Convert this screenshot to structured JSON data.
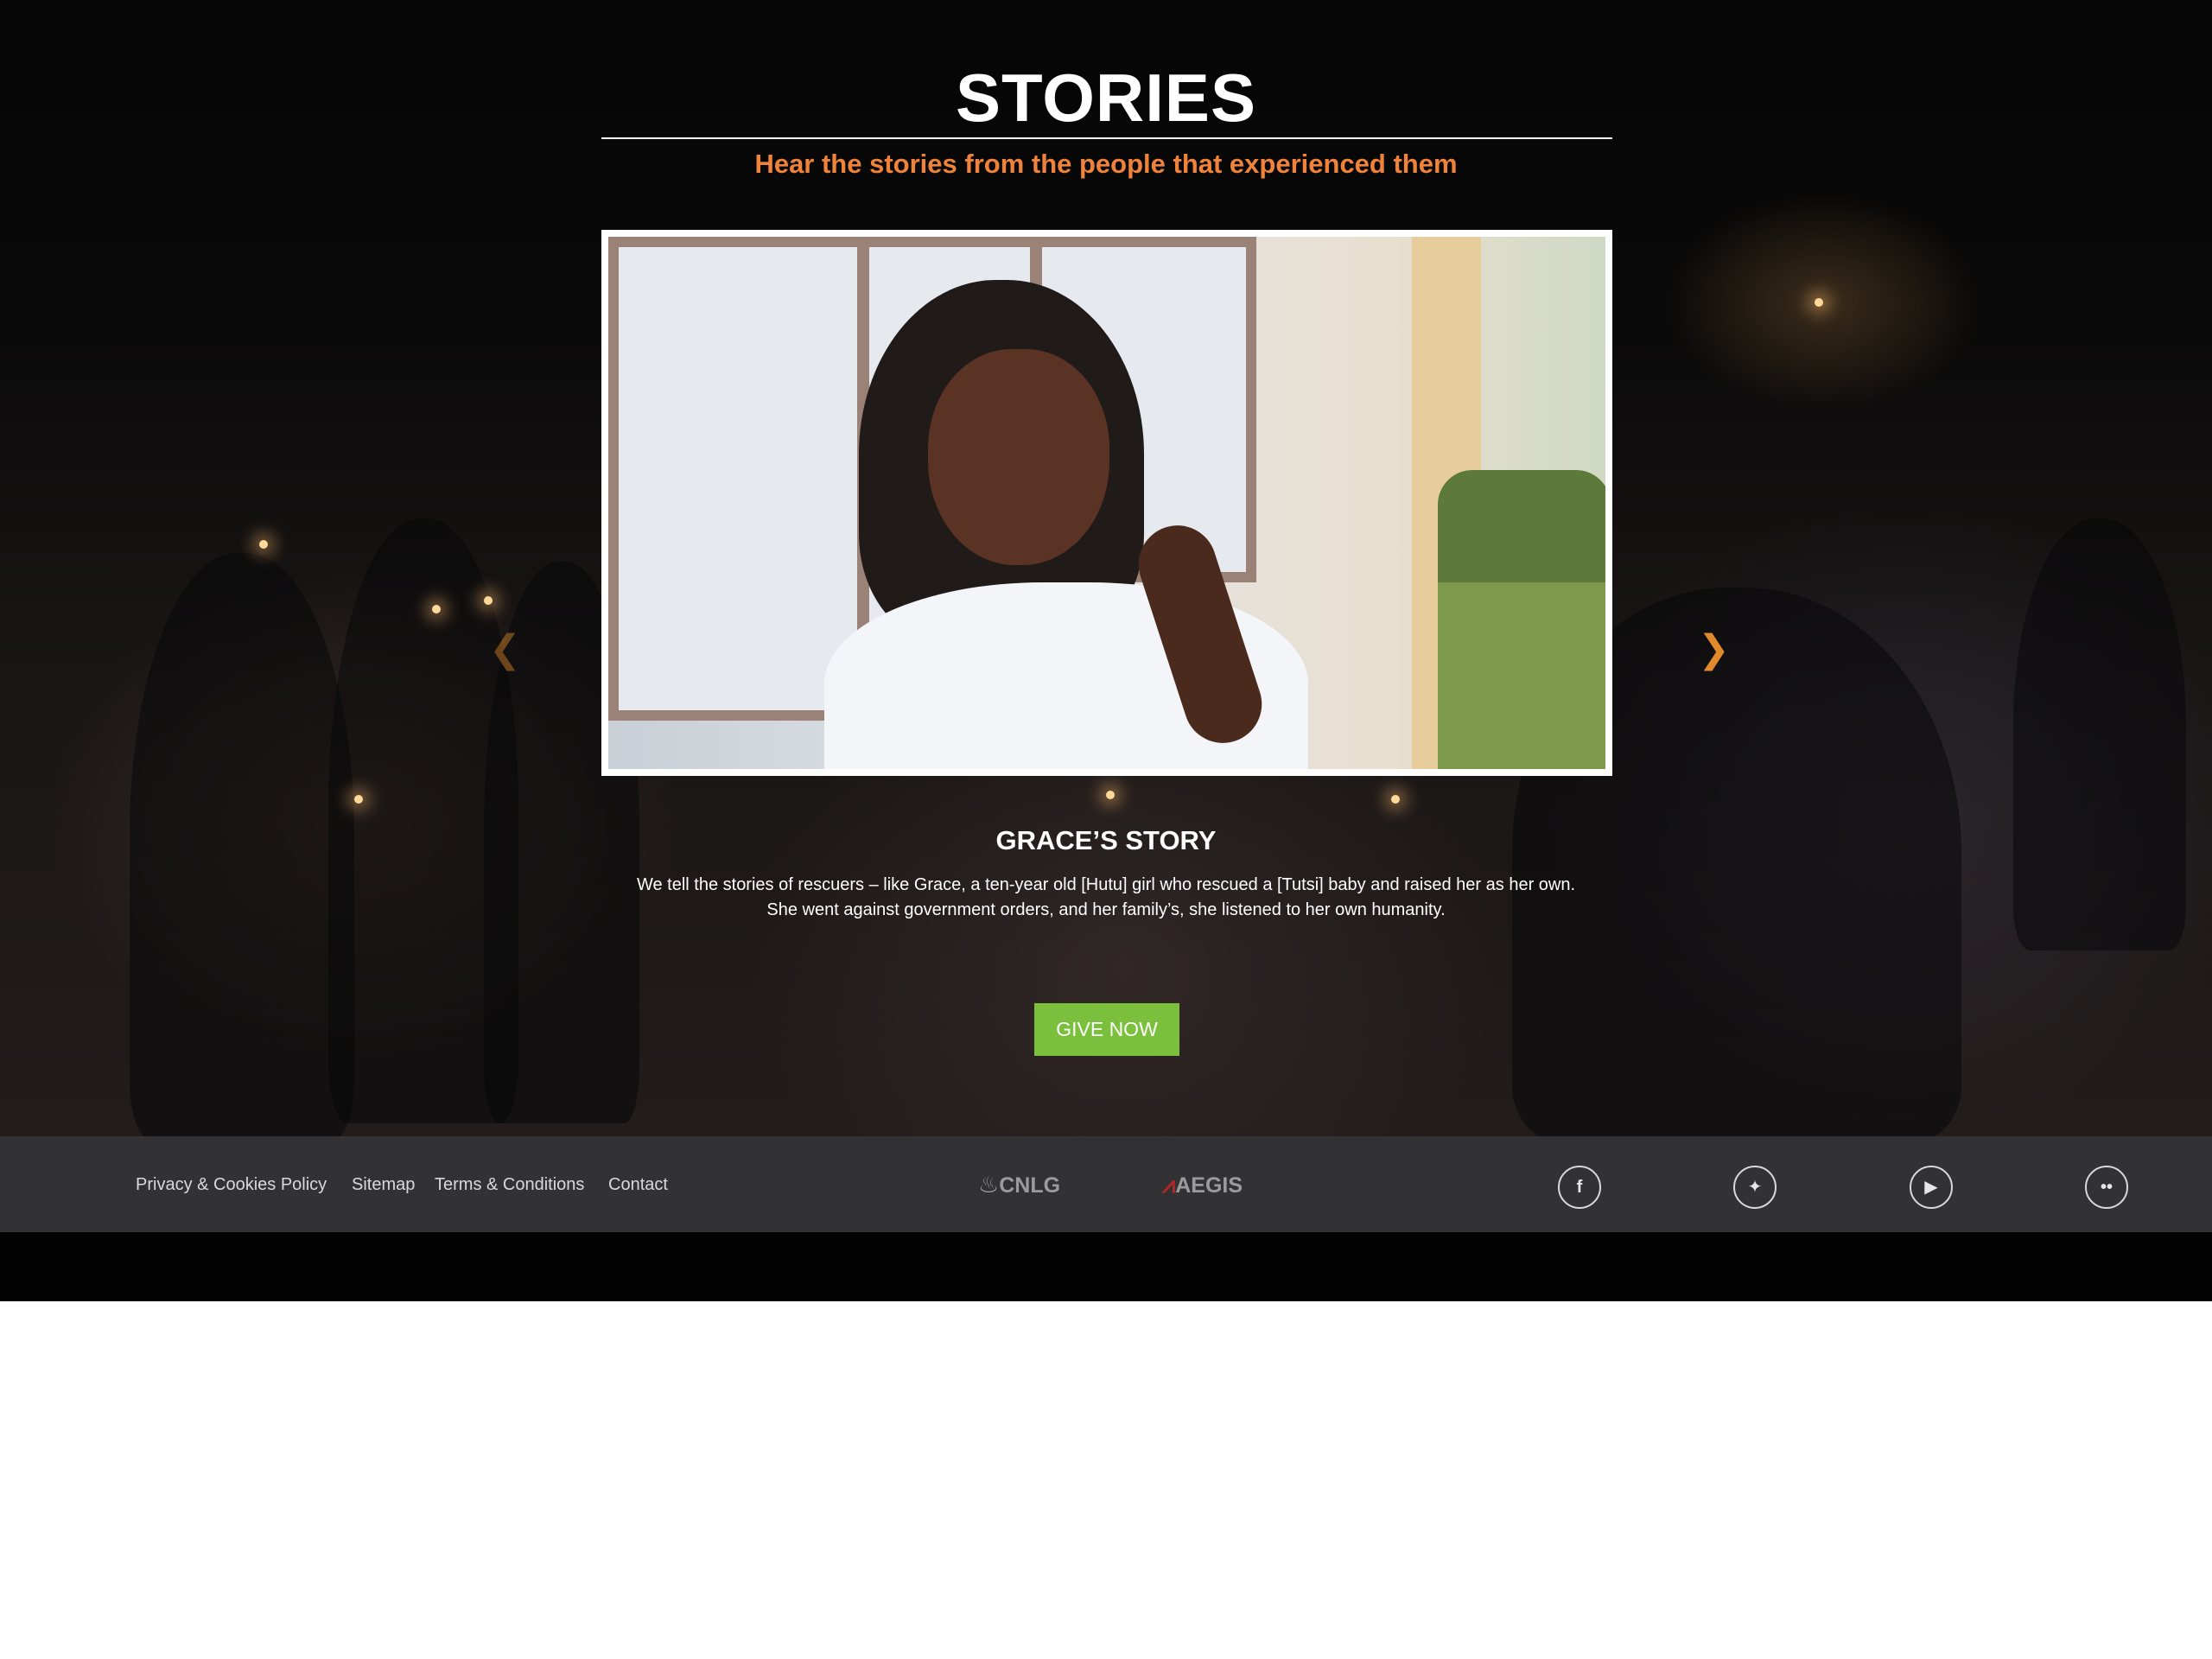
{
  "hero": {
    "title": "STORIES",
    "subtitle": "Hear the stories from the people that experienced them"
  },
  "carousel": {
    "prev_icon": "chevron-left-icon",
    "next_icon": "chevron-right-icon",
    "prev_glyph": "❮",
    "next_glyph": "❯"
  },
  "story": {
    "title": "GRACE’S STORY",
    "line1": "We tell the stories of rescuers – like Grace, a ten-year old [Hutu] girl who rescued a [Tutsi] baby and raised her as her own.",
    "line2": "She went against government orders, and her family’s, she listened to her own humanity."
  },
  "cta": {
    "label": "GIVE NOW",
    "color": "#7bc03c"
  },
  "footer": {
    "links": [
      "Privacy & Cookies Policy",
      "Sitemap",
      "Terms & Conditions",
      "Contact"
    ],
    "logos": [
      {
        "mark": "♨",
        "text": "CNLG"
      },
      {
        "mark": "⩘",
        "text": "AEGIS"
      }
    ],
    "social": [
      {
        "icon": "facebook-icon",
        "glyph": "f"
      },
      {
        "icon": "twitter-icon",
        "glyph": "✦"
      },
      {
        "icon": "youtube-icon",
        "glyph": "▶"
      },
      {
        "icon": "flickr-icon",
        "glyph": "••"
      }
    ]
  },
  "colors": {
    "accent_orange": "#f0833a",
    "footer_bg": "#323234",
    "hero_bg": "#0b0a0a"
  }
}
